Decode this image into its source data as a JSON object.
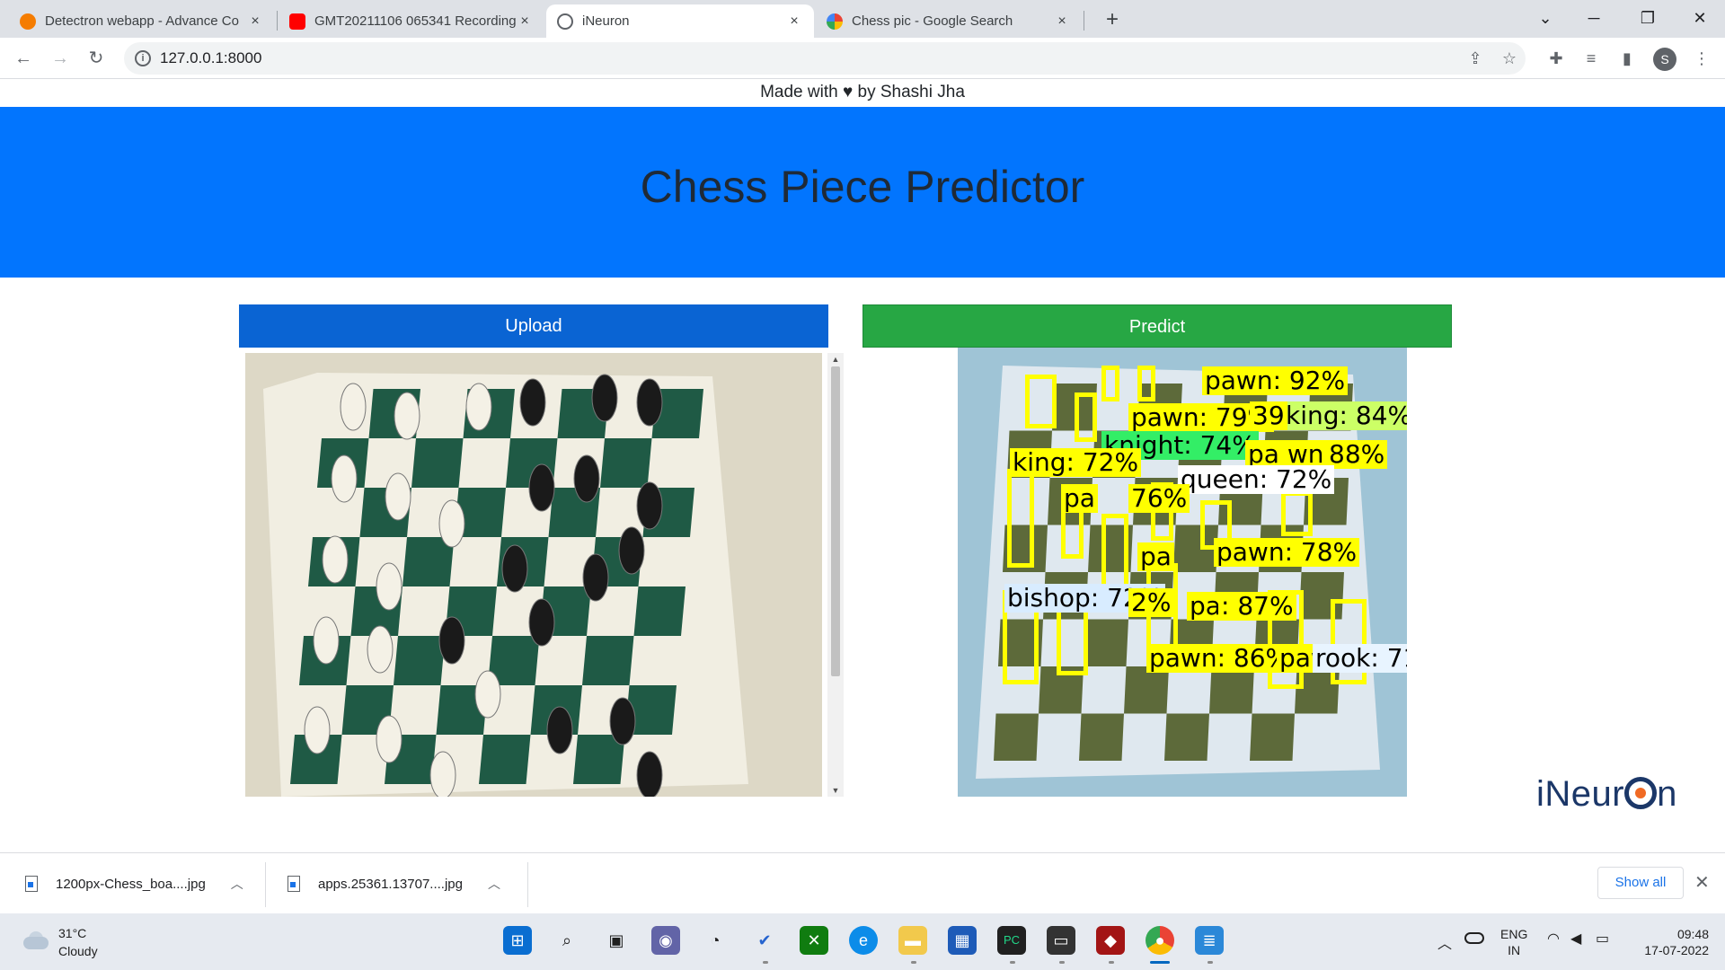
{
  "browser": {
    "tabs": [
      {
        "title": "Detectron webapp - Advance Co",
        "favicon_color": "#f57c00"
      },
      {
        "title": "GMT20211106 065341 Recording",
        "favicon_color": "#ff0000"
      },
      {
        "title": "iNeuron",
        "favicon_color": "#5f6368",
        "active": true
      },
      {
        "title": "Chess pic - Google Search",
        "favicon_color": "#4285f4"
      }
    ],
    "close_glyph": "×",
    "new_tab_glyph": "+",
    "url": "127.0.0.1:8000",
    "profile_initial": "S"
  },
  "page": {
    "made_with": "Made with ♥ by Shashi Jha",
    "title": "Chess Piece Predictor",
    "upload_label": "Upload",
    "predict_label": "Predict",
    "detections": [
      {
        "label": "pawn: 92%",
        "color": "#ffff00"
      },
      {
        "label": "king: 84%",
        "color": "#ccff66"
      },
      {
        "label": "pawn: 79%",
        "color": "#ffff00"
      },
      {
        "label": "39",
        "color": "#ffff00"
      },
      {
        "label": "knight: 74%",
        "color": "#33ee66"
      },
      {
        "label": "king: 72%",
        "color": "#ffff00"
      },
      {
        "label": "pa wn",
        "color": "#ffff00"
      },
      {
        "label": "88%",
        "color": "#ffff00"
      },
      {
        "label": "queen: 72%",
        "color": "#ffffff"
      },
      {
        "label": "pa",
        "color": "#ffff00"
      },
      {
        "label": "76%",
        "color": "#ffff00"
      },
      {
        "label": "pawn: 78%",
        "color": "#ffff00"
      },
      {
        "label": "pa",
        "color": "#ffff00"
      },
      {
        "label": "bishop: 72%",
        "color": "#d8ecff"
      },
      {
        "label": "2%",
        "color": "#ffff00"
      },
      {
        "label": "pa w",
        "color": "#ffff00"
      },
      {
        "label": ": 87%",
        "color": "#ffff00"
      },
      {
        "label": "pawn: 86%",
        "color": "#ffff00"
      },
      {
        "label": "paw",
        "color": "#ffff00"
      },
      {
        "label": "rook: 71",
        "color": "#e8f4ff"
      }
    ],
    "logo_pre": "iNeur",
    "logo_post": "n"
  },
  "downloads": {
    "items": [
      {
        "name": "1200px-Chess_boa....jpg"
      },
      {
        "name": "apps.25361.13707....jpg"
      }
    ],
    "show_all_label": "Show all"
  },
  "taskbar": {
    "temperature": "31°C",
    "condition": "Cloudy",
    "language": "ENG",
    "region": "IN",
    "time": "09:48",
    "date": "17-07-2022"
  },
  "colors": {
    "hero": "#0275fe",
    "upload": "#0a64d3",
    "predict": "#27a744"
  }
}
